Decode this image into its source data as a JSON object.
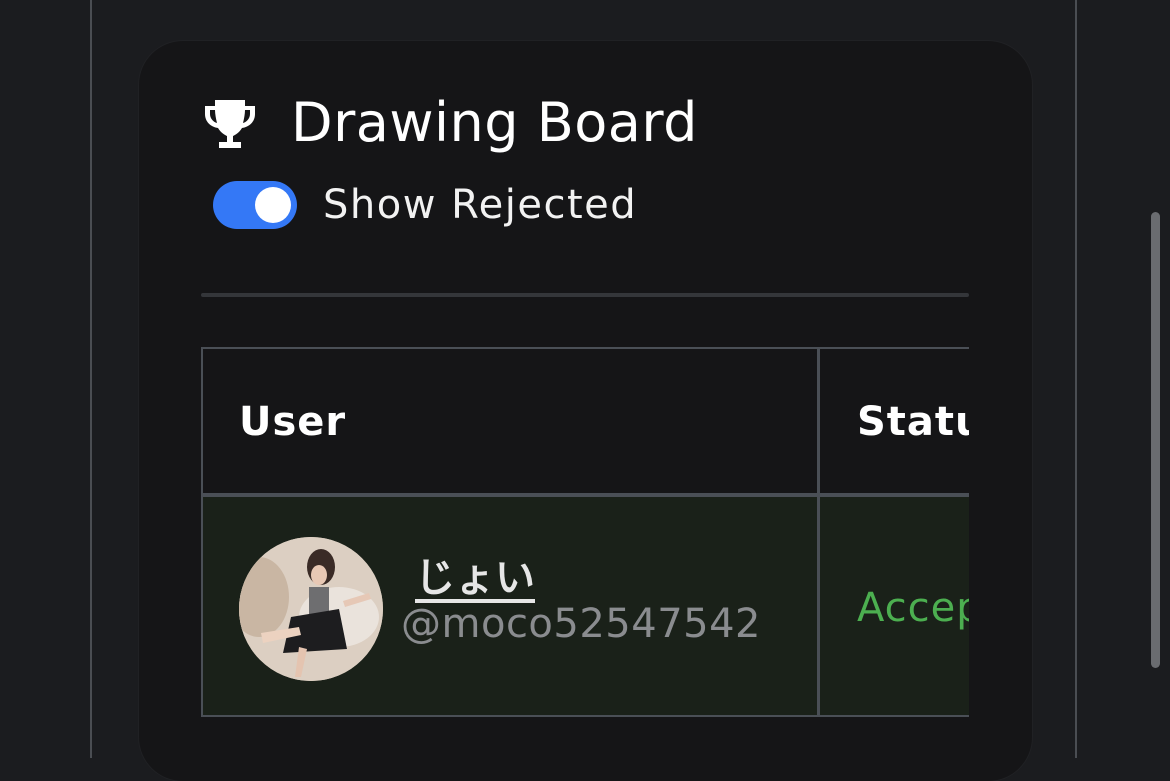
{
  "board": {
    "title": "Drawing Board",
    "title_icon": "trophy-icon"
  },
  "filters": {
    "show_rejected_label": "Show Rejected",
    "show_rejected_enabled": true,
    "toggle_color": "#3478f6"
  },
  "table": {
    "columns": [
      "User",
      "Statu"
    ],
    "rows": [
      {
        "user_name": "じょい",
        "user_handle": "@moco52547542",
        "status": "Accep",
        "status_color": "#4caf50",
        "row_background": "#1a2119"
      }
    ]
  }
}
